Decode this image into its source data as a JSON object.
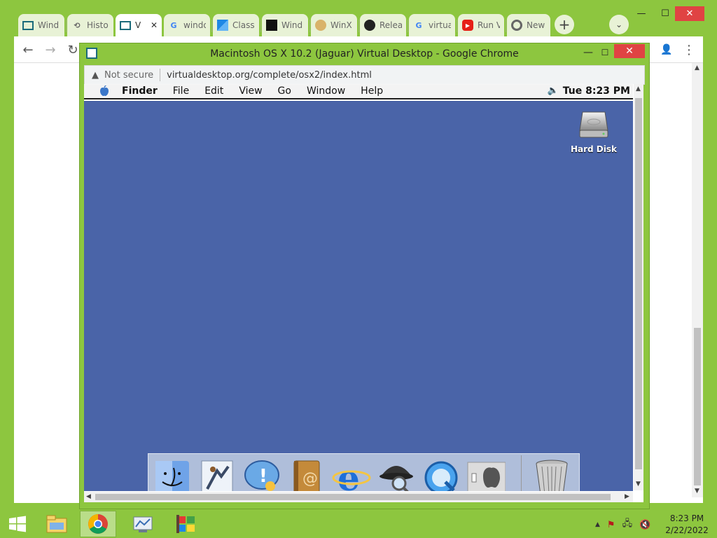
{
  "outer_browser": {
    "tabs": [
      {
        "label": "Wind",
        "icon": "page-icon"
      },
      {
        "label": "Histo",
        "icon": "history-icon"
      },
      {
        "label": "V",
        "icon": "page-icon",
        "active": true
      },
      {
        "label": "windo",
        "icon": "google-icon"
      },
      {
        "label": "Class",
        "icon": "classic-shell-icon"
      },
      {
        "label": "Wind",
        "icon": "terminal-icon"
      },
      {
        "label": "WinX",
        "icon": "doge-icon"
      },
      {
        "label": "Relea",
        "icon": "github-icon"
      },
      {
        "label": "virtua",
        "icon": "google-icon"
      },
      {
        "label": "Run V",
        "icon": "youtube-icon"
      },
      {
        "label": "New",
        "icon": "chrome-icon"
      }
    ],
    "newtab": "+",
    "tablist": "⌄",
    "controls": {
      "min": "—",
      "max": "☐",
      "close": "✕"
    },
    "nav": {
      "back": "←",
      "forward": "→",
      "reload": "↻",
      "profile": "👤",
      "menu": "⋮"
    }
  },
  "popup": {
    "title": "Macintosh OS X 10.2 (Jaguar) Virtual Desktop - Google Chrome",
    "controls": {
      "min": "—",
      "max": "☐",
      "close": "✕"
    },
    "security_text": "Not secure",
    "url": "virtualdesktop.org/complete/osx2/index.html"
  },
  "mac": {
    "menubar": {
      "apple": "",
      "items": [
        "Finder",
        "File",
        "Edit",
        "View",
        "Go",
        "Window",
        "Help"
      ],
      "clock": "Tue 8:23 PM",
      "speaker": "🔈"
    },
    "desktop_color": "#4a64a8",
    "hard_disk_label": "Hard Disk",
    "dock_items": [
      "finder-icon",
      "mail-icon",
      "ichat-icon",
      "address-book-icon",
      "internet-explorer-icon",
      "sherlock-icon",
      "quicktime-icon",
      "system-preferences-icon",
      "trash-icon"
    ]
  },
  "taskbar": {
    "time": "8:23 PM",
    "date": "2/22/2022",
    "tray_chevron": "▲"
  },
  "colors": {
    "chrome_frame": "#8dc63f",
    "close_red": "#e04343"
  }
}
